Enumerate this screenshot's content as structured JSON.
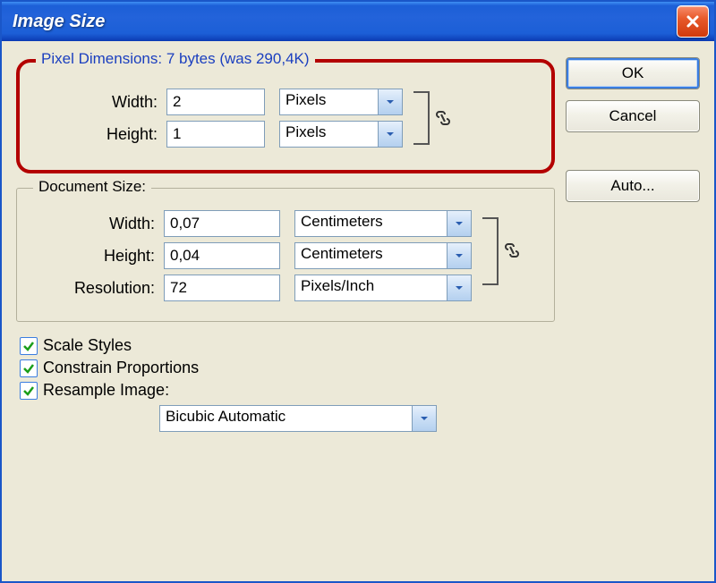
{
  "window": {
    "title": "Image Size"
  },
  "buttons": {
    "ok": "OK",
    "cancel": "Cancel",
    "auto": "Auto..."
  },
  "pixel": {
    "legend": "Pixel Dimensions:  7 bytes (was 290,4K)",
    "width_label": "Width:",
    "width_value": "2",
    "width_unit": "Pixels",
    "height_label": "Height:",
    "height_value": "1",
    "height_unit": "Pixels"
  },
  "doc": {
    "legend": "Document Size:",
    "width_label": "Width:",
    "width_value": "0,07",
    "width_unit": "Centimeters",
    "height_label": "Height:",
    "height_value": "0,04",
    "height_unit": "Centimeters",
    "res_label": "Resolution:",
    "res_value": "72",
    "res_unit": "Pixels/Inch"
  },
  "checks": {
    "scale": "Scale Styles",
    "constrain": "Constrain Proportions",
    "resample": "Resample Image:"
  },
  "resample_method": "Bicubic Automatic"
}
